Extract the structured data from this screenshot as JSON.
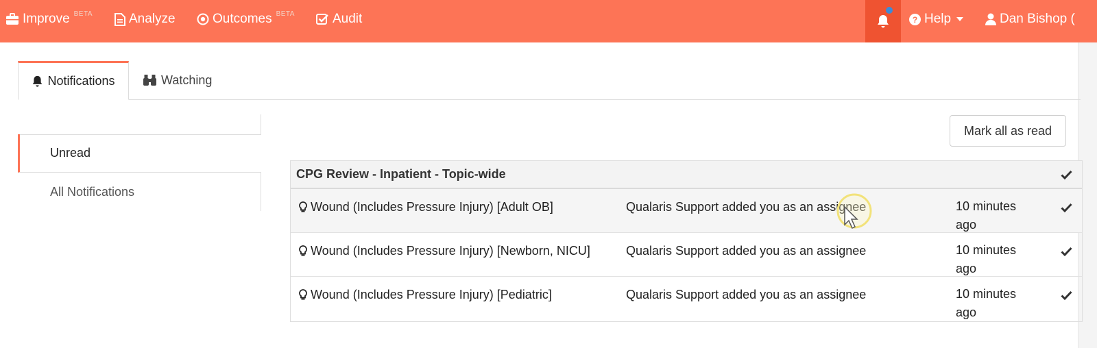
{
  "nav": {
    "improve_label": "Improve",
    "improve_badge": "BETA",
    "analyze_label": "Analyze",
    "outcomes_label": "Outcomes",
    "outcomes_badge": "BETA",
    "audit_label": "Audit",
    "help_label": "Help",
    "user_label": "Dan Bishop (",
    "accent_color": "#fd7456",
    "notification_indicator_color": "#3d8bd8"
  },
  "tabs": {
    "notifications_label": "Notifications",
    "watching_label": "Watching"
  },
  "sidebar": {
    "items": [
      {
        "label": "Unread"
      },
      {
        "label": "All Notifications"
      }
    ]
  },
  "actions": {
    "mark_all_label": "Mark all as read"
  },
  "group": {
    "title": "CPG Review - Inpatient - Topic-wide",
    "rows": [
      {
        "topic": "Wound (Includes Pressure Injury) [Adult OB]",
        "message": "Qualaris Support added you as an assignee",
        "time": "10 minutes ago"
      },
      {
        "topic": "Wound (Includes Pressure Injury) [Newborn, NICU]",
        "message": "Qualaris Support added you as an assignee",
        "time": "10 minutes ago"
      },
      {
        "topic": "Wound (Includes Pressure Injury) [Pediatric]",
        "message": "Qualaris Support added you as an assignee",
        "time": "10 minutes ago"
      }
    ]
  }
}
